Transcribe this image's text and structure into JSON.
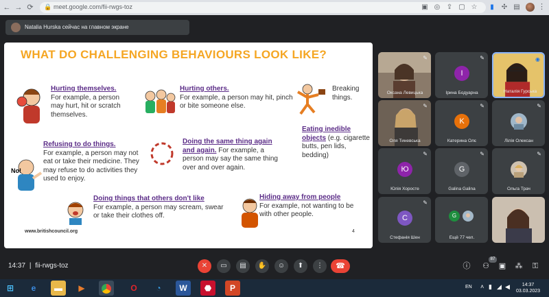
{
  "browser": {
    "url": "meet.google.com/fii-rwgs-toz"
  },
  "meet": {
    "presenter_text": "Natalia Hurska сейчас на главном экране",
    "time": "14:37",
    "separator": "|",
    "meeting_code": "fii-rwgs-toz",
    "participant_badge": "87"
  },
  "slide": {
    "title": "WHAT DO CHALLENGING BEHAVIOURS LOOK LIKE?",
    "blocks": [
      {
        "heading": "Hurting themselves.",
        "body": "For example, a person may hurt, hit or scratch themselves."
      },
      {
        "heading": "Hurting others.",
        "body": "For example, a person may hit, pinch or bite someone else."
      },
      {
        "heading": "",
        "body": "Breaking things."
      },
      {
        "heading": "Refusing to do things.",
        "body": "For example, a person may not eat or take their medicine. They may refuse to do activities they used to enjoy."
      },
      {
        "heading": "Doing the same thing again and again.",
        "body": "For example, a person may say the same thing over and over again."
      },
      {
        "heading": "Eating inedible objects",
        "body": "(e.g. cigarette butts, pen lids, bedding)"
      },
      {
        "heading": "Doing things that others don't like",
        "body": "For example, a person may scream, swear or take their clothes off."
      },
      {
        "heading": "Hiding away from people",
        "body": "For example, not wanting to be with other people."
      }
    ],
    "no_sign": "No!",
    "footer": "www.britishcouncil.org",
    "page_number": "4"
  },
  "participants": [
    {
      "name": "Оксана Левицька",
      "initial": "",
      "color": ""
    },
    {
      "name": "Ірина Бодуарна",
      "initial": "I",
      "color": "#8e24aa"
    },
    {
      "name": "Наталія Гурська",
      "initial": "",
      "color": ""
    },
    {
      "name": "Оля Тиневська",
      "initial": "",
      "color": ""
    },
    {
      "name": "Катерина Олє",
      "initial": "K",
      "color": "#e8710a"
    },
    {
      "name": "Лілія Олексан",
      "initial": "",
      "color": ""
    },
    {
      "name": "Юлія Хоросте",
      "initial": "Ю",
      "color": "#8e24aa"
    },
    {
      "name": "Galina Galina",
      "initial": "G",
      "color": "#5f6368"
    },
    {
      "name": "Ольга Трач",
      "initial": "",
      "color": ""
    },
    {
      "name": "Стефанія Шен",
      "initial": "C",
      "color": "#7e57c2"
    },
    {
      "name": "Ещё 77 чел.",
      "initial": "G",
      "color": "#5f6368"
    },
    {
      "name": "",
      "initial": "",
      "color": ""
    }
  ],
  "taskbar": {
    "lang": "EN",
    "clock_time": "14:37",
    "clock_date": "03.03.2023"
  }
}
